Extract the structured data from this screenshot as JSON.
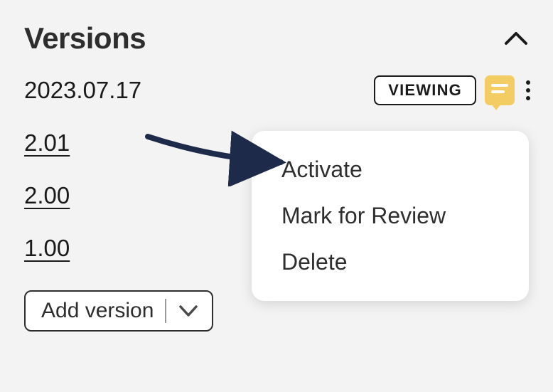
{
  "header": {
    "title": "Versions"
  },
  "current_version": {
    "label": "2023.07.17",
    "badge": "VIEWING"
  },
  "versions": [
    {
      "label": "2.01"
    },
    {
      "label": "2.00"
    },
    {
      "label": "1.00"
    }
  ],
  "add_version_label": "Add version",
  "menu": {
    "activate": "Activate",
    "mark_review": "Mark for Review",
    "delete": "Delete"
  }
}
